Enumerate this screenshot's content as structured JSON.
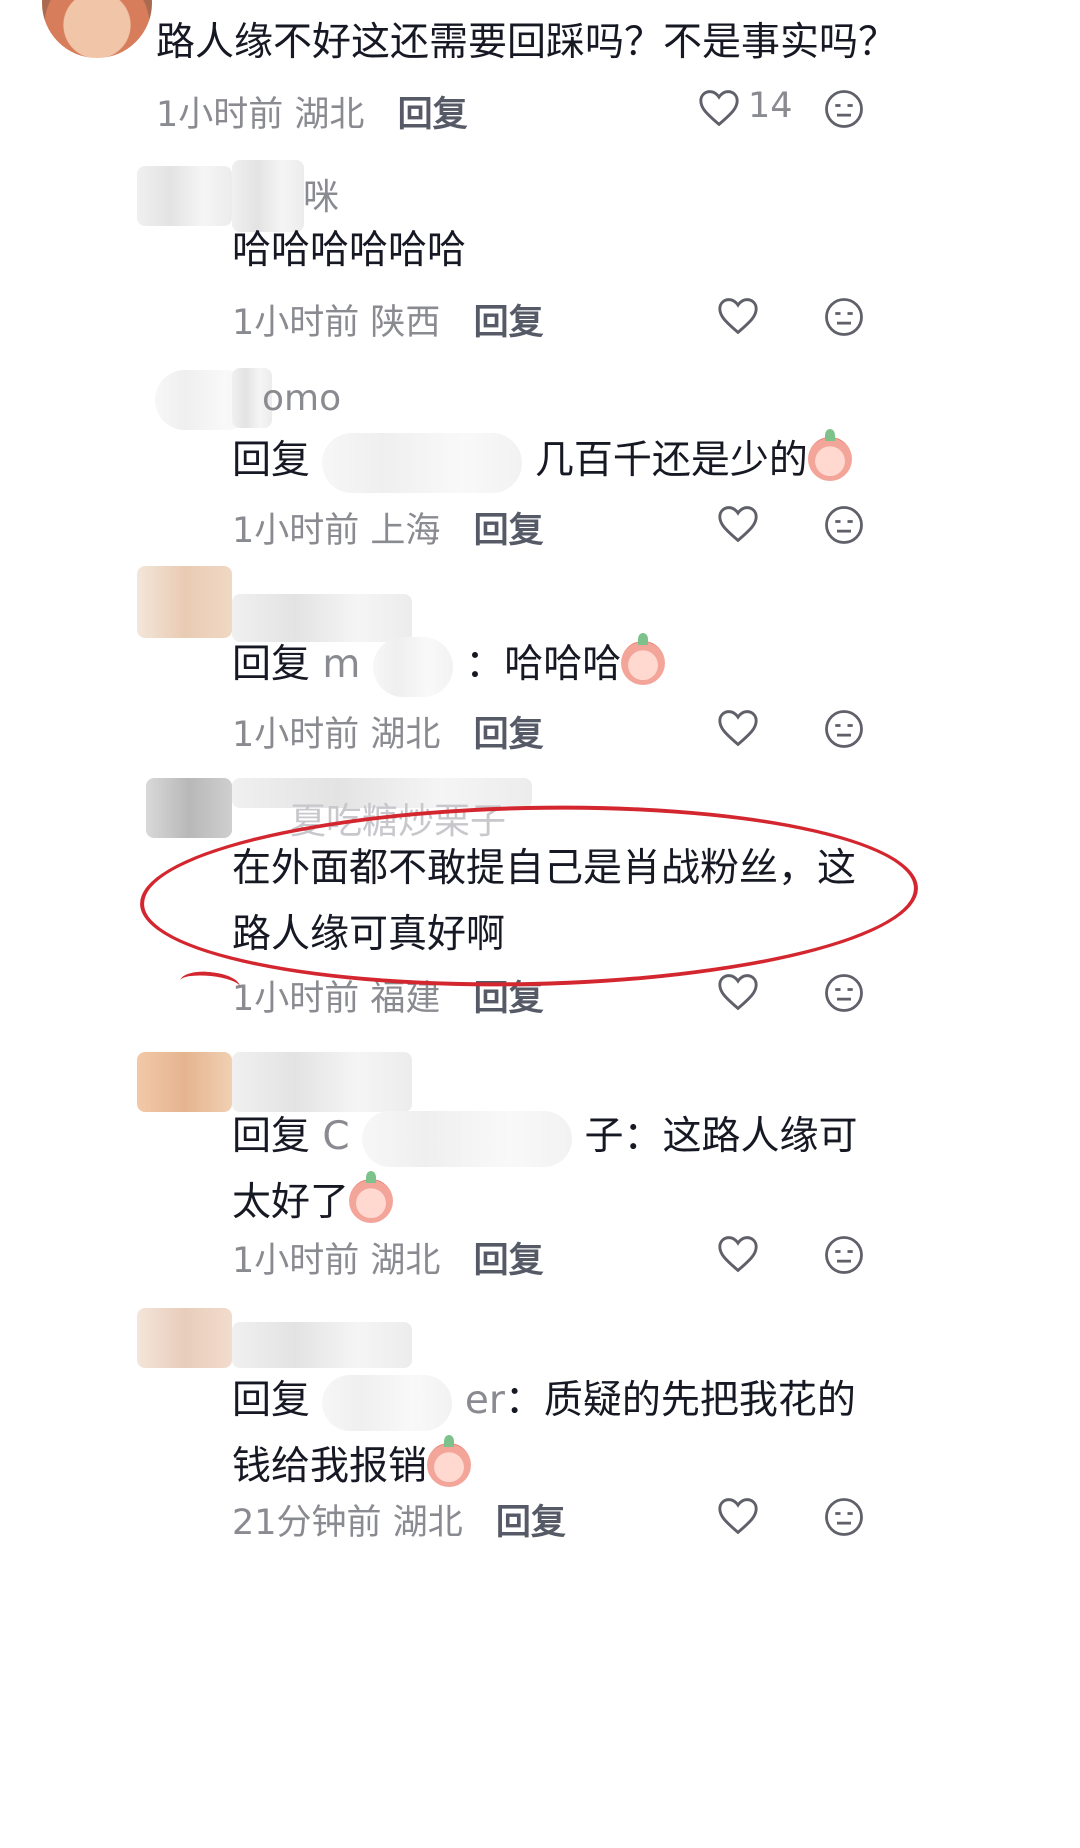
{
  "top_comment": {
    "text": "路人缘不好这还需要回踩吗？不是事实吗？",
    "time": "1小时前",
    "location": "湖北",
    "reply_label": "回复",
    "like_count": "14"
  },
  "replies": [
    {
      "name_visible": "咪",
      "text": "哈哈哈哈哈哈",
      "time": "1小时前",
      "location": "陕西",
      "reply_label": "回复"
    },
    {
      "name_visible": "omo",
      "text_prefix": "回复",
      "text_suffix": "几百千还是少的",
      "time": "1小时前",
      "location": "上海",
      "reply_label": "回复"
    },
    {
      "text_prefix": "回复",
      "text_mid": "m",
      "text_suffix": "：哈哈哈",
      "time": "1小时前",
      "location": "湖北",
      "reply_label": "回复"
    },
    {
      "name_visible": "夏吃糖炒栗子",
      "text": "在外面都不敢提自己是肖战粉丝，这路人缘可真好啊",
      "time": "1小时前",
      "location": "福建",
      "reply_label": "回复"
    },
    {
      "text_prefix": "回复",
      "text_mid": "C",
      "text_suffix": "子：这路人缘可太好了",
      "time": "1小时前",
      "location": "湖北",
      "reply_label": "回复"
    },
    {
      "text_prefix": "回复",
      "text_mid": "er",
      "text_suffix": "：质疑的先把我花的钱给我报销",
      "time": "21分钟前",
      "location": "湖北",
      "reply_label": "回复"
    }
  ],
  "icons": {
    "like": "heart-outline-icon",
    "dislike": "neutral-face-icon",
    "emoji": "peach-face-emoji"
  },
  "colors": {
    "annotation": "#d3262e",
    "meta_text": "#8a8b91",
    "body_text": "#161823"
  }
}
